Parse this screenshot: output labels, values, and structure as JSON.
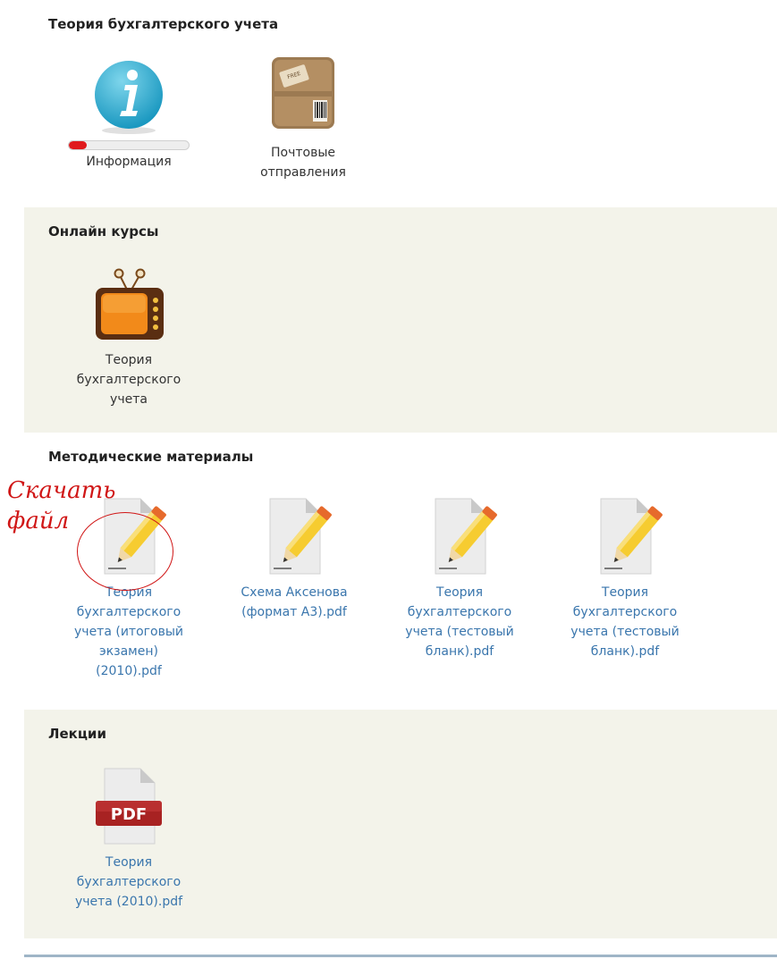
{
  "sections": [
    {
      "title": "Теория бухгалтерского учета",
      "items": [
        {
          "label": "Информация",
          "icon": "info-icon",
          "progress": 0.15
        },
        {
          "label": "Почтовые\nотправления",
          "icon": "package-icon"
        }
      ]
    },
    {
      "title": "Онлайн курсы",
      "items": [
        {
          "label": "Теория\nбухгалтерского\nучета",
          "icon": "tv-icon"
        }
      ]
    },
    {
      "title": "Методические материалы",
      "items": [
        {
          "label": "Теория\nбухгалтерского\nучета (итоговый\nэкзамен)\n(2010).pdf",
          "icon": "document-edit-icon"
        },
        {
          "label": "Схема Аксенова\n(формат А3).pdf",
          "icon": "document-edit-icon"
        },
        {
          "label": "Теория\nбухгалтерского\nучета (тестовый\nбланк).pdf",
          "icon": "document-edit-icon"
        },
        {
          "label": "Теория\nбухгалтерского\nучета (тестовый\nбланк).pdf",
          "icon": "document-edit-icon"
        }
      ]
    },
    {
      "title": "Лекции",
      "items": [
        {
          "label": "Теория\nбухгалтерского\nучета (2010).pdf",
          "icon": "pdf-file-icon",
          "badge": "PDF"
        }
      ]
    }
  ],
  "annotation": {
    "text": "Скачать\nфайл",
    "color": "#d01616"
  },
  "colors": {
    "link": "#3a76ad",
    "shaded_bg": "#f3f3ea",
    "progress": "#e0191c"
  }
}
